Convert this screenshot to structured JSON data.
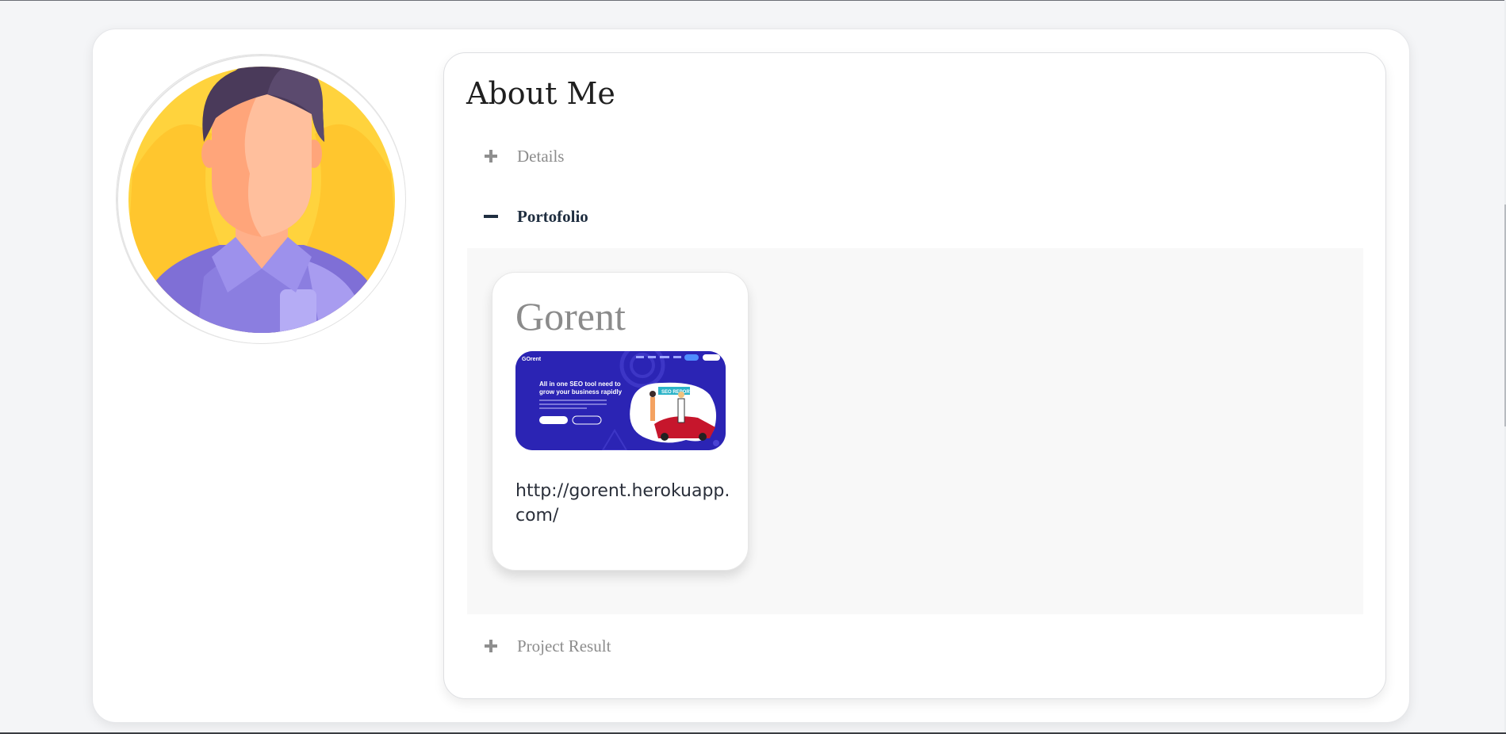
{
  "profile": {
    "avatar_alt": "User avatar"
  },
  "about": {
    "title": "About Me",
    "sections": [
      {
        "label": "Details",
        "state": "collapsed"
      },
      {
        "label": "Portofolio",
        "state": "expanded"
      },
      {
        "label": "Project Result",
        "state": "collapsed"
      }
    ]
  },
  "portfolio": {
    "items": [
      {
        "title": "Gorent",
        "url": "http://gorent.herokuapp.com/",
        "thumbnail": {
          "brand": "GOrent",
          "headline_line1": "All in one SEO tool need to",
          "headline_line2": "grow your business rapidly",
          "badge": "SEO REPORT"
        }
      }
    ]
  },
  "colors": {
    "accent_dark": "#1f2e40",
    "muted": "#8c8c8c",
    "thumb_bg": "#2b24b4",
    "avatar_bg": "#ffd33d",
    "shirt": "#8b7ee0"
  },
  "icons": {
    "expand": "plus-icon",
    "collapse": "minus-icon"
  }
}
